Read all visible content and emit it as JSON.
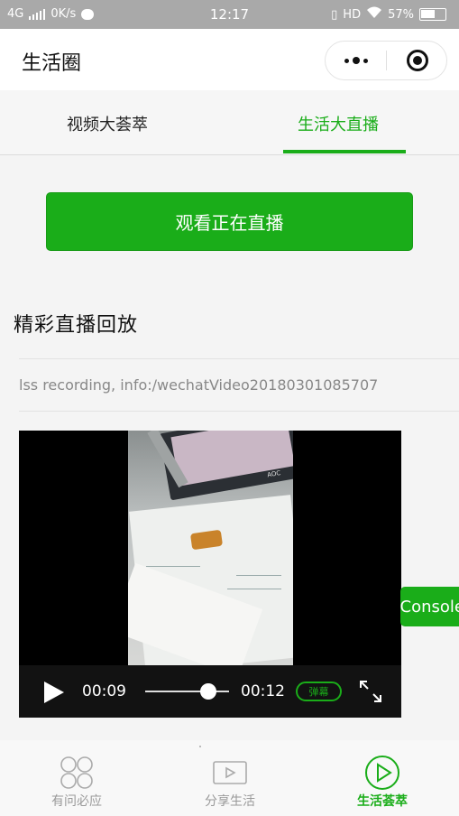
{
  "status_bar": {
    "network": "4G",
    "speed": "0K/s",
    "time": "12:17",
    "hd": "HD",
    "battery": "57%"
  },
  "nav": {
    "title": "生活圈"
  },
  "tabs": [
    {
      "label": "视频大荟萃",
      "active": false
    },
    {
      "label": "生活大直播",
      "active": true
    }
  ],
  "main": {
    "watch_live_label": "观看正在直播",
    "section_title": "精彩直播回放",
    "recording_name": "lss recording, info:/wechatVideo20180301085707"
  },
  "video": {
    "current_time": "00:09",
    "duration": "00:12",
    "progress": 0.75,
    "danmu_label": "弹幕",
    "monitor_brand": "AOC"
  },
  "vconsole": {
    "label": "vConsole"
  },
  "tabbar": [
    {
      "label": "有问必应",
      "icon": "grid-circles-icon",
      "active": false
    },
    {
      "label": "分享生活",
      "icon": "video-camera-icon",
      "active": false
    },
    {
      "label": "生活荟萃",
      "icon": "play-circle-icon",
      "active": true
    }
  ],
  "colors": {
    "accent": "#1aad19",
    "status_bar": "#a9a9a9",
    "inactive_tab": "#999999"
  }
}
